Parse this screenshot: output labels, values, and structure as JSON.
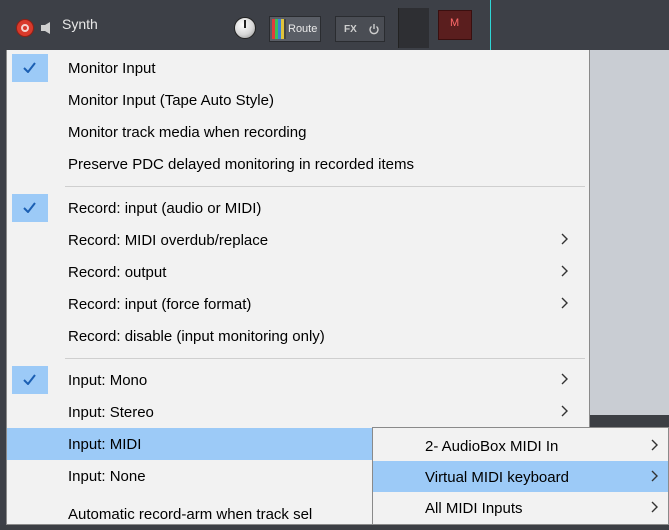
{
  "track": {
    "name": "Synth",
    "route_label": "Route",
    "fx_label": "FX",
    "mute_label": "M"
  },
  "menu": {
    "items": [
      {
        "label": "Monitor Input",
        "checked": true
      },
      {
        "label": "Monitor Input (Tape Auto Style)"
      },
      {
        "label": "Monitor track media when recording"
      },
      {
        "label": "Preserve PDC delayed monitoring in recorded items"
      },
      {
        "label": "Record: input (audio or MIDI)",
        "checked": true
      },
      {
        "label": "Record: MIDI overdub/replace",
        "submenu": true
      },
      {
        "label": "Record: output",
        "submenu": true
      },
      {
        "label": "Record: input (force format)",
        "submenu": true
      },
      {
        "label": "Record: disable (input monitoring only)"
      },
      {
        "label": "Input: Mono",
        "checked": true,
        "submenu": true
      },
      {
        "label": "Input: Stereo",
        "submenu": true
      },
      {
        "label": "Input: MIDI",
        "submenu": true,
        "highlighted": true
      },
      {
        "label": "Input: None"
      },
      {
        "label": "Automatic record-arm when track sel"
      }
    ]
  },
  "submenu": {
    "items": [
      {
        "label": "2- AudioBox MIDI In",
        "submenu": true
      },
      {
        "label": "Virtual MIDI keyboard",
        "submenu": true,
        "highlighted": true
      },
      {
        "label": "All MIDI Inputs",
        "submenu": true
      }
    ]
  },
  "colors": {
    "highlight": "#9ccaf7",
    "menu_bg": "#f2f2f2",
    "record_red": "#d93a2b"
  }
}
